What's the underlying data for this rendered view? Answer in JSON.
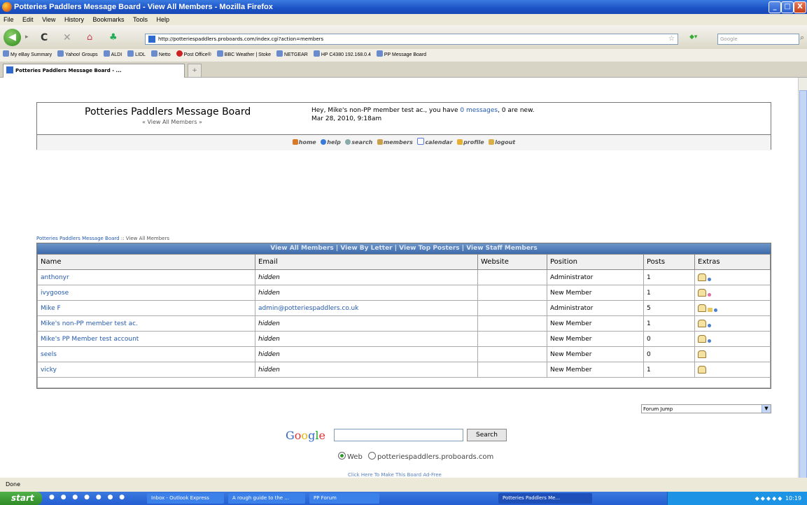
{
  "window": {
    "title": "Potteries Paddlers Message Board - View All Members - Mozilla Firefox",
    "min": "_",
    "max": "□",
    "close": "X"
  },
  "menu": [
    "File",
    "Edit",
    "View",
    "History",
    "Bookmarks",
    "Tools",
    "Help"
  ],
  "nav": {
    "back_icon": "arrow-left-icon",
    "url": "http://potteriespaddlers.proboards.com/index.cgi?action=members",
    "search_placeholder": "Google"
  },
  "bookmarks": [
    "My eBay Summary",
    "Yahoo! Groups",
    "ALDI",
    "LIDL",
    "Netto",
    "Post Office®",
    "BBC Weather | Stoke",
    "NETGEAR",
    "HP C4380 192.168.0.4",
    "PP Message Board"
  ],
  "tab": {
    "label": "Potteries Paddlers Message Board - ...",
    "new": "+"
  },
  "header": {
    "board_name": "Potteries Paddlers Message Board",
    "sub": "« View All Members »",
    "welcome_pre": "Hey, Mike's non-PP member test ac., you have ",
    "messages_link": "0 messages",
    "welcome_post": ", 0 are new.",
    "date": "Mar 28, 2010, 9:18am",
    "menu_items": [
      "home",
      "help",
      "search",
      "members",
      "calendar",
      "profile",
      "logout"
    ]
  },
  "breadcrumb": {
    "board": "Potteries Paddlers Message Board",
    "sep": " :: ",
    "page": "View All Members"
  },
  "member_tabs": "View All Members | View By Letter | View Top Posters | View Staff Members",
  "columns": [
    "Name",
    "Email",
    "Website",
    "Position",
    "Posts",
    "Extras"
  ],
  "members": [
    {
      "name": "anthonyr",
      "email": "hidden",
      "website": "",
      "position": "Administrator",
      "posts": "1"
    },
    {
      "name": "ivygoose",
      "email": "hidden",
      "website": "",
      "position": "New Member",
      "posts": "1"
    },
    {
      "name": "Mike F",
      "email": "admin@potteriespaddlers.co.uk",
      "website": "",
      "position": "Administrator",
      "posts": "5"
    },
    {
      "name": "Mike's non-PP member test ac.",
      "email": "hidden",
      "website": "",
      "position": "New Member",
      "posts": "1"
    },
    {
      "name": "Mike's PP Member test account",
      "email": "hidden",
      "website": "",
      "position": "New Member",
      "posts": "0"
    },
    {
      "name": "seels",
      "email": "hidden",
      "website": "",
      "position": "New Member",
      "posts": "0"
    },
    {
      "name": "vicky",
      "email": "hidden",
      "website": "",
      "position": "New Member",
      "posts": "1"
    }
  ],
  "forum_jump": "Forum Jump",
  "google": {
    "logo": "Google",
    "button": "Search",
    "opt_web": "Web",
    "opt_site": "potteriespaddlers.proboards.com"
  },
  "ad_line": "Click Here To Make This Board Ad-Free",
  "status": "Done",
  "taskbar": {
    "start": "start",
    "tasks": [
      "Inbox - Outlook Express",
      "A rough guide to the ...",
      "PP Forum",
      "Potteries Paddlers Me..."
    ],
    "clock": "10:19"
  },
  "colors": {
    "link": "#2259b0",
    "tabs_bg": "#3d6aab",
    "titlebar": "#1c52c5"
  }
}
